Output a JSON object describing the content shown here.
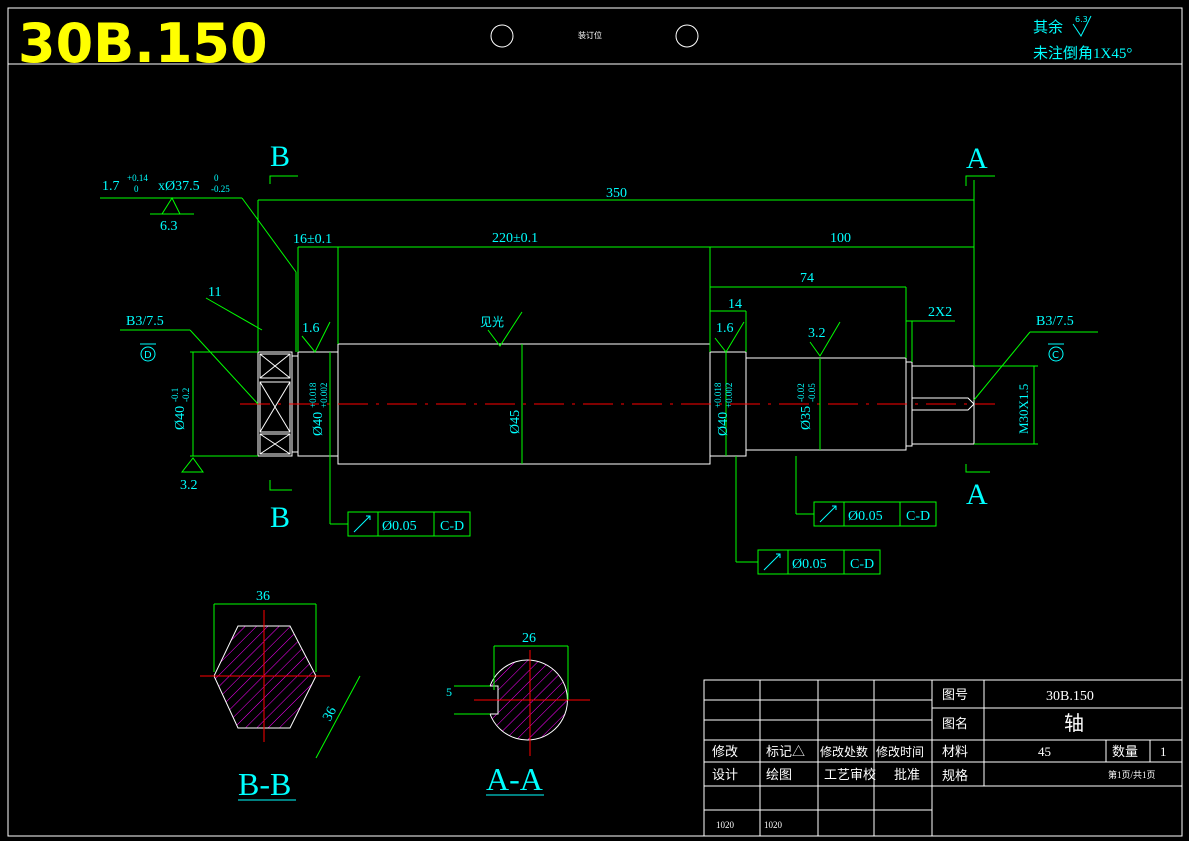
{
  "colors": {
    "background": "#000000",
    "frame": "#ffffff",
    "dimension": "#00ff00",
    "text_cyan": "#00ffff",
    "title_yellow": "#ffff00",
    "center_line": "#ff0000",
    "hatch": "#ff00ff",
    "outline": "#ffffff"
  },
  "header": {
    "drawing_code": "30B.150",
    "binding_label": "装订位",
    "note_line1": "其余",
    "note_roughness": "6.3",
    "note_line2": "未注倒角1X45°"
  },
  "main_view": {
    "section_mark_B": "B",
    "section_mark_A": "A",
    "dim_total": "350",
    "dim_16": "16±0.1",
    "dim_220": "220±0.1",
    "dim_100": "100",
    "dim_74": "74",
    "dim_14": "14",
    "dim_2x2": "2X2",
    "dim_11": "11",
    "groove_main": "1.7",
    "groove_tol_up": "+0.14",
    "groove_tol_low": "0",
    "groove_dia": "xØ37.5",
    "groove_dia_up": "0",
    "groove_dia_low": "-0.25",
    "rough_63": "6.3",
    "rough_16a": "1.6",
    "rough_16b": "1.6",
    "rough_32a": "3.2",
    "rough_32b": "3.2",
    "rough_polish": "见光",
    "center_hole_left": "B3/7.5",
    "center_hole_right": "B3/7.5",
    "datum_D": "D",
    "datum_C": "C",
    "dia_40_left": "Ø40",
    "dia_40_left_up": "-0.1",
    "dia_40_left_low": "-0.2",
    "dia_40_b": "Ø40",
    "dia_40_b_up": "+0.018",
    "dia_40_b_low": "+0.002",
    "dia_45": "Ø45",
    "dia_40_c": "Ø40",
    "dia_40_c_up": "+0.018",
    "dia_40_c_low": "+0.002",
    "dia_35": "Ø35",
    "dia_35_up": "-0.02",
    "dia_35_low": "-0.05",
    "thread": "M30X1.5",
    "tol_value": "Ø0.05",
    "tol_datum": "C-D"
  },
  "section_bb": {
    "label": "B-B",
    "dim_top": "36",
    "dim_side": "36"
  },
  "section_aa": {
    "label": "A-A",
    "dim_top": "26",
    "dim_left": "5"
  },
  "title_block": {
    "drawing_no_label": "图号",
    "drawing_no": "30B.150",
    "name_label": "图名",
    "name": "轴",
    "material_label": "材料",
    "material": "45",
    "qty_label": "数量",
    "qty": "1",
    "spec_label": "规格",
    "page": "第1页/共1页",
    "revise": "修改",
    "mark": "标记△",
    "revise_count": "修改处数",
    "revise_time": "修改时间",
    "design": "设计",
    "draw": "绘图",
    "process": "工艺",
    "check": "审校",
    "approve": "批准",
    "design_val": "1020",
    "draw_val": "1020"
  }
}
